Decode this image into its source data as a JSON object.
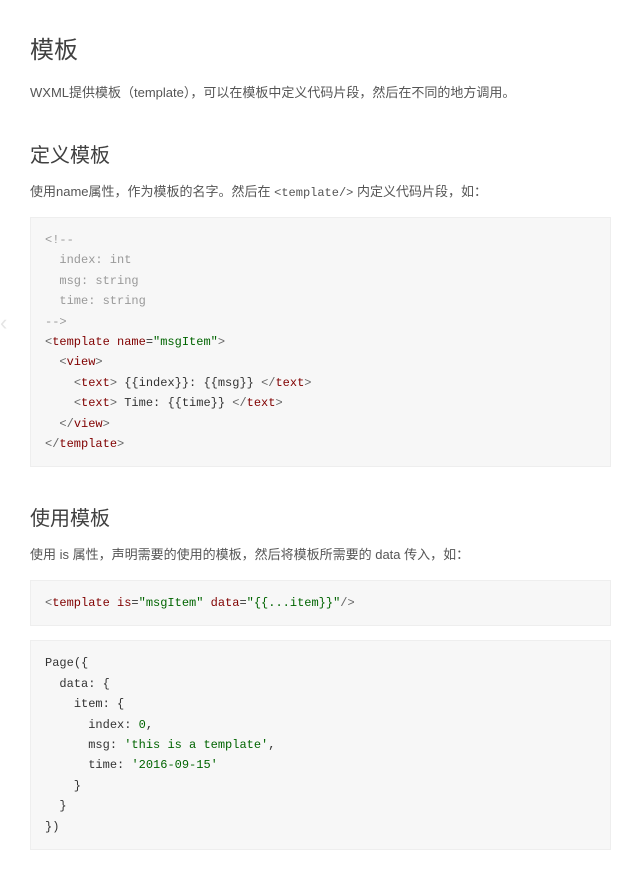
{
  "headings": {
    "h1": "模板",
    "h2_define": "定义模板",
    "h2_use": "使用模板"
  },
  "paragraphs": {
    "intro": "WXML提供模板（template），可以在模板中定义代码片段，然后在不同的地方调用。",
    "define_pre": "使用name属性，作为模板的名字。然后在 ",
    "define_code": "<template/>",
    "define_post": " 内定义代码片段，如：",
    "use": "使用 is 属性，声明需要的使用的模板，然后将模板所需要的 data 传入，如："
  },
  "code_define": {
    "comment": "<!--\n  index: int\n  msg: string\n  time: string\n-->",
    "template_open": "template",
    "name_attr": "name",
    "name_val": "\"msgItem\"",
    "view_tag": "view",
    "text_tag": "text",
    "line1_content": " {{index}}: {{msg}} ",
    "line2_content": " Time: {{time}} "
  },
  "code_use": {
    "template": "template",
    "is_attr": "is",
    "is_val": "\"msgItem\"",
    "data_attr": "data",
    "data_val": "\"{{...item}}\""
  },
  "code_page": {
    "page": "Page",
    "data_key": "data",
    "item_key": "item",
    "index_key": "index",
    "index_val": "0",
    "msg_key": "msg",
    "msg_val": "'this is a template'",
    "time_key": "time",
    "time_val": "'2016-09-15'"
  },
  "nav": {
    "chevron": "‹"
  }
}
